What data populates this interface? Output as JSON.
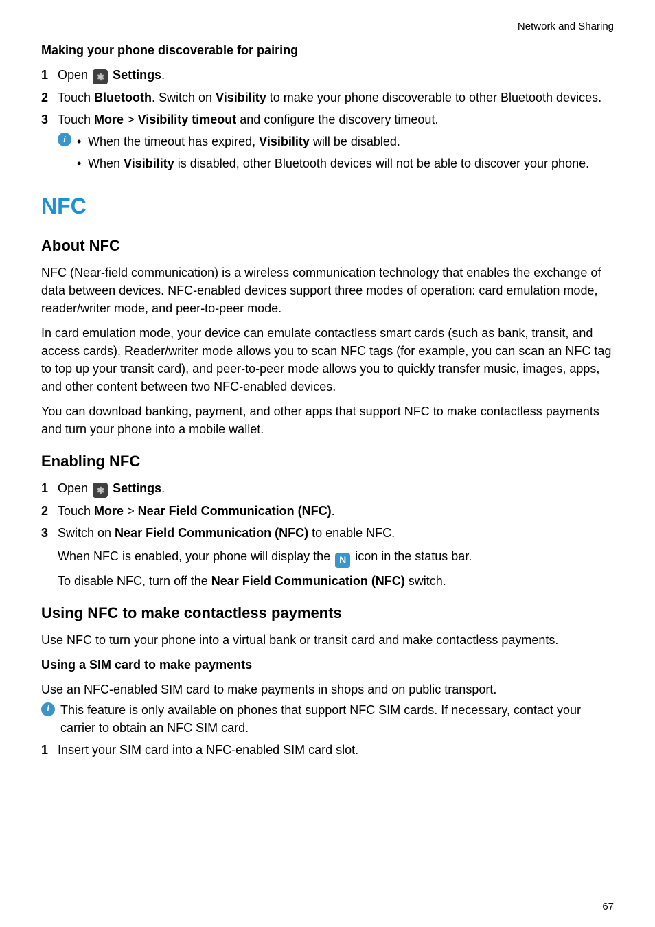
{
  "header": {
    "category": "Network and Sharing"
  },
  "section_pairing": {
    "title": "Making your phone discoverable for pairing",
    "steps": [
      {
        "num": "1",
        "parts": [
          "Open ",
          "ICON_SETTINGS",
          " ",
          "BOLD:Settings",
          "."
        ]
      },
      {
        "num": "2",
        "parts": [
          "Touch ",
          "BOLD:Bluetooth",
          ". Switch on ",
          "BOLD:Visibility",
          " to make your phone discoverable to other Bluetooth devices."
        ]
      },
      {
        "num": "3",
        "parts": [
          "Touch ",
          "BOLD:More",
          " > ",
          "BOLD:Visibility timeout",
          " and configure the discovery timeout."
        ]
      }
    ],
    "info_bullets": [
      {
        "parts": [
          "When the timeout has expired, ",
          "BOLD:Visibility",
          " will be disabled."
        ]
      },
      {
        "parts": [
          "When ",
          "BOLD:Visibility",
          " is disabled, other Bluetooth devices will not be able to discover your phone."
        ]
      }
    ]
  },
  "section_nfc": {
    "title": "NFC",
    "about": {
      "heading": "About NFC",
      "p1": "NFC (Near-field communication) is a wireless communication technology that enables the exchange of data between devices. NFC-enabled devices support three modes of operation: card emulation mode, reader/writer mode, and peer-to-peer mode.",
      "p2": "In card emulation mode, your device can emulate contactless smart cards (such as bank, transit, and access cards). Reader/writer mode allows you to scan NFC tags (for example, you can scan an NFC tag to top up your transit card), and peer-to-peer mode allows you to quickly transfer music, images, apps, and other content between two NFC-enabled devices.",
      "p3": "You can download banking, payment, and other apps that support NFC to make contactless payments and turn your phone into a mobile wallet."
    },
    "enabling": {
      "heading": "Enabling NFC",
      "steps": [
        {
          "num": "1",
          "parts": [
            "Open ",
            "ICON_SETTINGS",
            " ",
            "BOLD:Settings",
            "."
          ]
        },
        {
          "num": "2",
          "parts": [
            "Touch ",
            "BOLD:More",
            " > ",
            "BOLD:Near Field Communication (NFC)",
            "."
          ]
        },
        {
          "num": "3",
          "parts": [
            "Switch on ",
            "BOLD:Near Field Communication (NFC)",
            " to enable NFC."
          ]
        }
      ],
      "post": [
        {
          "parts": [
            "When NFC is enabled, your phone will display the ",
            "ICON_NFC",
            " icon in the status bar."
          ]
        },
        {
          "parts": [
            "To disable NFC, turn off the ",
            "BOLD:Near Field Communication (NFC)",
            " switch."
          ]
        }
      ]
    },
    "payments": {
      "heading": "Using NFC to make contactless payments",
      "intro": "Use NFC to turn your phone into a virtual bank or transit card and make contactless payments.",
      "sim": {
        "heading": "Using a SIM card to make payments",
        "intro": "Use an NFC-enabled SIM card to make payments in shops and on public transport.",
        "note": "This feature is only available on phones that support NFC SIM cards. If necessary, contact your carrier to obtain an NFC SIM card.",
        "steps": [
          {
            "num": "1",
            "text": "Insert your SIM card into a NFC-enabled SIM card slot."
          }
        ]
      }
    }
  },
  "page_number": "67"
}
